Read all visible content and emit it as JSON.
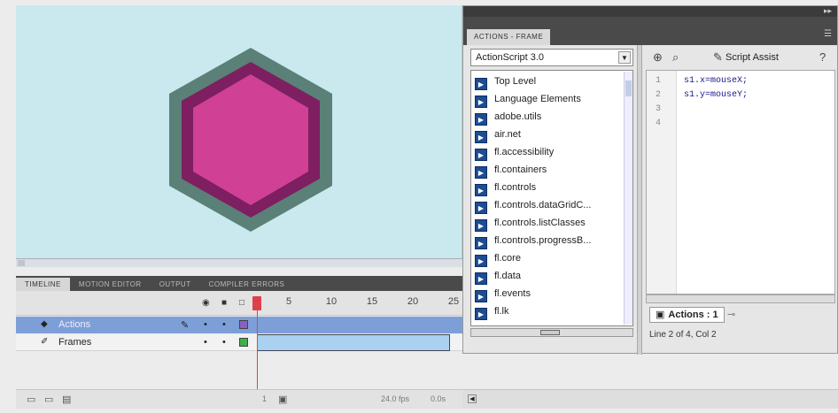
{
  "timeline": {
    "tabs": [
      "TIMELINE",
      "MOTION EDITOR",
      "OUTPUT",
      "COMPILER ERRORS"
    ],
    "header_icons": [
      "eye-icon",
      "lock-icon",
      "outline-icon"
    ],
    "frame_numbers": [
      "5",
      "10",
      "15",
      "20",
      "25"
    ],
    "layers": [
      {
        "name": "Actions",
        "selected": true
      },
      {
        "name": "Frames",
        "selected": false
      }
    ],
    "footer": {
      "fps": "24.0 fps",
      "time": "0.0s",
      "frame": "1"
    }
  },
  "stage": {
    "background": "#c9e9ef",
    "hexagon": {
      "outer": "#5b8077",
      "middle": "#7d1f60",
      "inner": "#d04095"
    }
  },
  "actions_panel": {
    "tab_label": "ACTIONS - FRAME",
    "language_select": "ActionScript 3.0",
    "tree_items": [
      "Top Level",
      "Language Elements",
      "adobe.utils",
      "air.net",
      "fl.accessibility",
      "fl.containers",
      "fl.controls",
      "fl.controls.dataGridC...",
      "fl.controls.listClasses",
      "fl.controls.progressB...",
      "fl.core",
      "fl.data",
      "fl.events",
      "fl.lk"
    ],
    "toolbar": {
      "script_assist_label": "Script Assist"
    },
    "code_lines": [
      {
        "num": "1",
        "text": "s1.x=mouseX;"
      },
      {
        "num": "2",
        "text": "s1.y=mouseY;"
      },
      {
        "num": "3",
        "text": ""
      },
      {
        "num": "4",
        "text": ""
      }
    ],
    "script_tab": "Actions : 1",
    "status": "Line 2 of 4, Col 2"
  }
}
